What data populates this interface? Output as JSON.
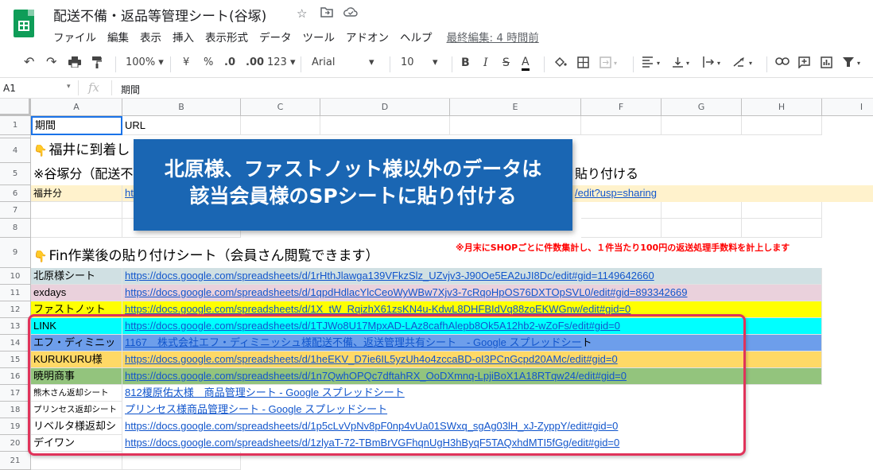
{
  "doc": {
    "title": "配送不備・返品等管理シート(谷塚)",
    "menu": [
      "ファイル",
      "編集",
      "表示",
      "挿入",
      "表示形式",
      "データ",
      "ツール",
      "アドオン",
      "ヘルプ"
    ],
    "last_edit": "最終編集: 4 時間前"
  },
  "toolbar": {
    "zoom": "100%",
    "currency": "¥",
    "percent": "%",
    "dec_less": ".0",
    "dec_more": ".00",
    "format_more": "123",
    "font": "Arial",
    "size": "10",
    "bold": "B",
    "italic": "I",
    "strike": "S",
    "text_color": "A"
  },
  "formula": {
    "namebox": "A1",
    "fx": "fx",
    "value": "期間"
  },
  "columns": [
    "A",
    "B",
    "C",
    "D",
    "E",
    "F",
    "G",
    "H",
    "I"
  ],
  "rows": {
    "r1": {
      "num": "1",
      "a": "期間",
      "b": "URL"
    },
    "r4": {
      "num": "4",
      "a": "福井に到着し"
    },
    "r5": {
      "num": "5",
      "a": "※谷塚分（配送不",
      "e": "貼り付ける"
    },
    "r6": {
      "num": "6",
      "a": "福井分",
      "b": "ht",
      "e": "/edit?usp=sharing"
    },
    "r7": {
      "num": "7"
    },
    "r8": {
      "num": "8"
    },
    "r9": {
      "num": "9",
      "a": "Fin作業後の貼り付けシート（会員さん閲覧できます）",
      "note": "※月末にSHOPごとに件数集計し、１件当たり100円の返送処理手数料を計上します"
    },
    "r10": {
      "num": "10",
      "a": "北原様シート",
      "b": "https://docs.google.com/spreadsheets/d/1rHthJlawga139VFkzSlz_UZvjv3-J90Oe5EA2uJI8Dc/edit#gid=1149642660"
    },
    "r11": {
      "num": "11",
      "a": "exdays",
      "b": "https://docs.google.com/spreadsheets/d/1qpdHdlacYlcCeoWyWBw7Xjv3-7cRqoHpOS76DXTOpSVL0/edit#gid=893342669"
    },
    "r12": {
      "num": "12",
      "a": "ファストノット",
      "b": "https://docs.google.com/spreadsheets/d/1X_tW_RqizhX61zsKN4u-KdwL8DHFBIdVq88zoEKWGnw/edit#gid=0"
    },
    "r13": {
      "num": "13",
      "a": "LINK",
      "b": "https://docs.google.com/spreadsheets/d/1TJWo8U17MpxAD-LAz8cafhAlepb8Ok5A12hb2-wZoFs/edit#gid=0"
    },
    "r14": {
      "num": "14",
      "a": "エフ・ディミニッ",
      "b": "1167　株式会社エフ・ディミニッシュ様配送不備、返送管理共有シート　- Google スプレッドシー",
      "b2": "ト"
    },
    "r15": {
      "num": "15",
      "a": "KURUKURU様",
      "b": "https://docs.google.com/spreadsheets/d/1heEKV_D7ie6IL5yzUh4o4zccaBD-oI3PCnGcpd20AMc/edit#gid=0"
    },
    "r16": {
      "num": "16",
      "a": "暁明商事",
      "b": "https://docs.google.com/spreadsheets/d/1n7QwhOPQc7dftahRX_OoDXmnq-LpjiBoX1A18RTqw24/edit#gid=0"
    },
    "r17": {
      "num": "17",
      "a": "熊木さん返却シート",
      "b": "812榎原佑太様　商品管理シート - Google スプレッドシート"
    },
    "r18": {
      "num": "18",
      "a": "プリンセス返却シート",
      "b": "プリンセス様商品管理シート - Google スプレッドシート"
    },
    "r19": {
      "num": "19",
      "a": "リベルタ様返却シ",
      "b": "https://docs.google.com/spreadsheets/d/1p5cLvVpNv8pF0np4vUa01SWxq_sgAg03lH_xJ-ZyppY/edit#gid=0"
    },
    "r20": {
      "num": "20",
      "a": "デイワン",
      "b": "https://docs.google.com/spreadsheets/d/1zlyaT-72-TBmBrVGFhqnUgH3hByqF5TAQxhdMTI5fGg/edit#gid=0"
    },
    "r21": {
      "num": "21"
    }
  },
  "banner": {
    "line1": "北原様、ファストノット様以外のデータは",
    "line2": "該当会員様のSPシートに貼り付ける"
  },
  "colors": {
    "row10": "#d0e0e3",
    "row11": "#ead1dc",
    "row12": "#ffff00",
    "row13": "#00ffff",
    "row14": "#6d9eeb",
    "row15": "#ffd966",
    "row16": "#93c47d",
    "row6": "#fff2cc",
    "banner": "#1a66b3",
    "frame": "#e0335a",
    "note": "#ff0000"
  }
}
